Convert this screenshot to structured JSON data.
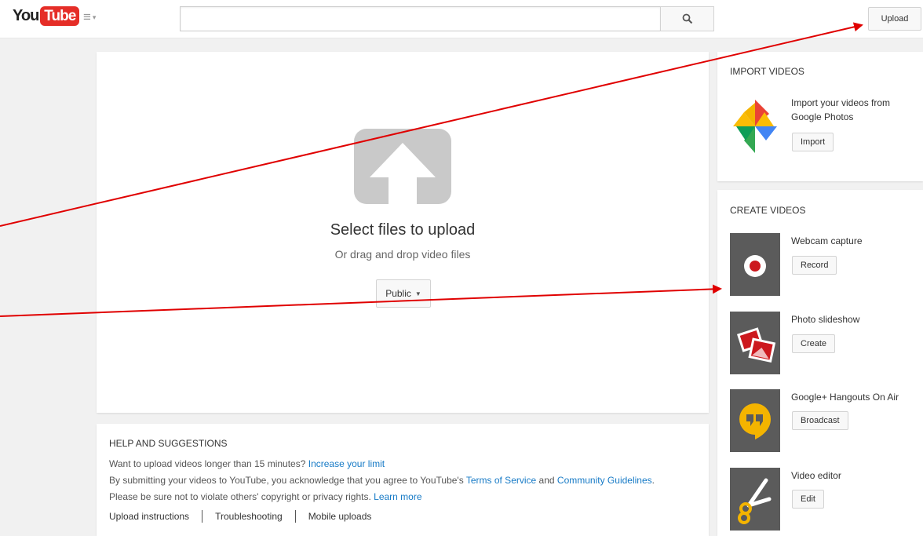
{
  "header": {
    "logo_you": "You",
    "logo_tube": "Tube",
    "guide_icon": "menu-icon",
    "search_icon": "search-icon",
    "search_value": "",
    "upload_label": "Upload"
  },
  "upload": {
    "icon": "upload-arrow-icon",
    "title": "Select files to upload",
    "subtitle": "Or drag and drop video files",
    "privacy_label": "Public"
  },
  "help": {
    "title": "HELP AND SUGGESTIONS",
    "line1_text": "Want to upload videos longer than 15 minutes?",
    "line1_link": "Increase your limit",
    "line2_text": "By submitting your videos to YouTube, you acknowledge that you agree to YouTube's",
    "line2_link1": "Terms of Service",
    "line2_and": "and",
    "line2_link2": "Community Guidelines",
    "line2_end": ".",
    "line3_text": "Please be sure not to violate others' copyright or privacy rights.",
    "line3_link": "Learn more",
    "links": [
      "Upload instructions",
      "Troubleshooting",
      "Mobile uploads"
    ]
  },
  "import": {
    "title": "IMPORT VIDEOS",
    "text_line1": "Import your videos from",
    "text_line2": "Google Photos",
    "button": "Import",
    "icon": "google-photos-icon"
  },
  "create": {
    "title": "CREATE VIDEOS",
    "items": [
      {
        "label": "Webcam capture",
        "button": "Record",
        "icon": "record-icon"
      },
      {
        "label": "Photo slideshow",
        "button": "Create",
        "icon": "photos-icon"
      },
      {
        "label": "Google+ Hangouts On Air",
        "button": "Broadcast",
        "icon": "hangouts-icon"
      },
      {
        "label": "Video editor",
        "button": "Edit",
        "icon": "scissors-icon"
      }
    ]
  },
  "colors": {
    "brand_red": "#e52d27",
    "link_blue": "#167ac6",
    "annotation_arrow": "#e00000"
  }
}
